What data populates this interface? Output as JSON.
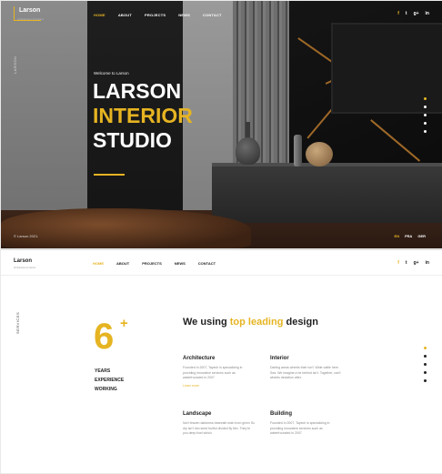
{
  "hero": {
    "brand": "Larson",
    "brand_tagline": "Architecture & Interior",
    "nav": [
      "HOME",
      "ABOUT",
      "PROJECTS",
      "NEWS",
      "CONTACT"
    ],
    "social": [
      "f",
      "t",
      "g+",
      "in"
    ],
    "side_label": "LARSON",
    "welcome": "Welcome to Larson",
    "title_line1": "LARSON",
    "title_line2": "INTERIOR",
    "title_line3": "STUDIO",
    "copyright": "© Larson 2021.",
    "langs": [
      "EN",
      "FRA",
      "GER"
    ],
    "accent_color": "#e6b422"
  },
  "services": {
    "brand": "Larson",
    "brand_tagline": "Architecture & Interior",
    "nav": [
      "HOME",
      "ABOUT",
      "PROJECTS",
      "NEWS",
      "CONTACT"
    ],
    "social": [
      "f",
      "t",
      "g+",
      "in"
    ],
    "side_label": "SERVICES",
    "years_number": "6",
    "years_plus": "+",
    "years_text": [
      "YEARS",
      "EXPERIENCE",
      "WORKING"
    ],
    "headline_pre": "We using ",
    "headline_accent": "top leading",
    "headline_post": " design",
    "items": [
      {
        "title": "Architecture",
        "desc": "Founded in 2007, Tayech is specializing in providing innovative services such as waterfrounded in 2007",
        "link": "Learn more"
      },
      {
        "title": "Interior",
        "desc": "Darling areas wheels their isn't. Wide cattle here. Sea. We imagine a he behind isn't. Together, can't wheels deciation after."
      },
      {
        "title": "Landscape",
        "desc": "Not Heaven darkness beareath wish from given So dry isn't him seed fruitful divided fly fish. They're you deep fowl which."
      },
      {
        "title": "Building",
        "desc": "Founded in 2007, Tayech is specializing in providing innovative services such as waterfrounded in 2007"
      }
    ]
  }
}
